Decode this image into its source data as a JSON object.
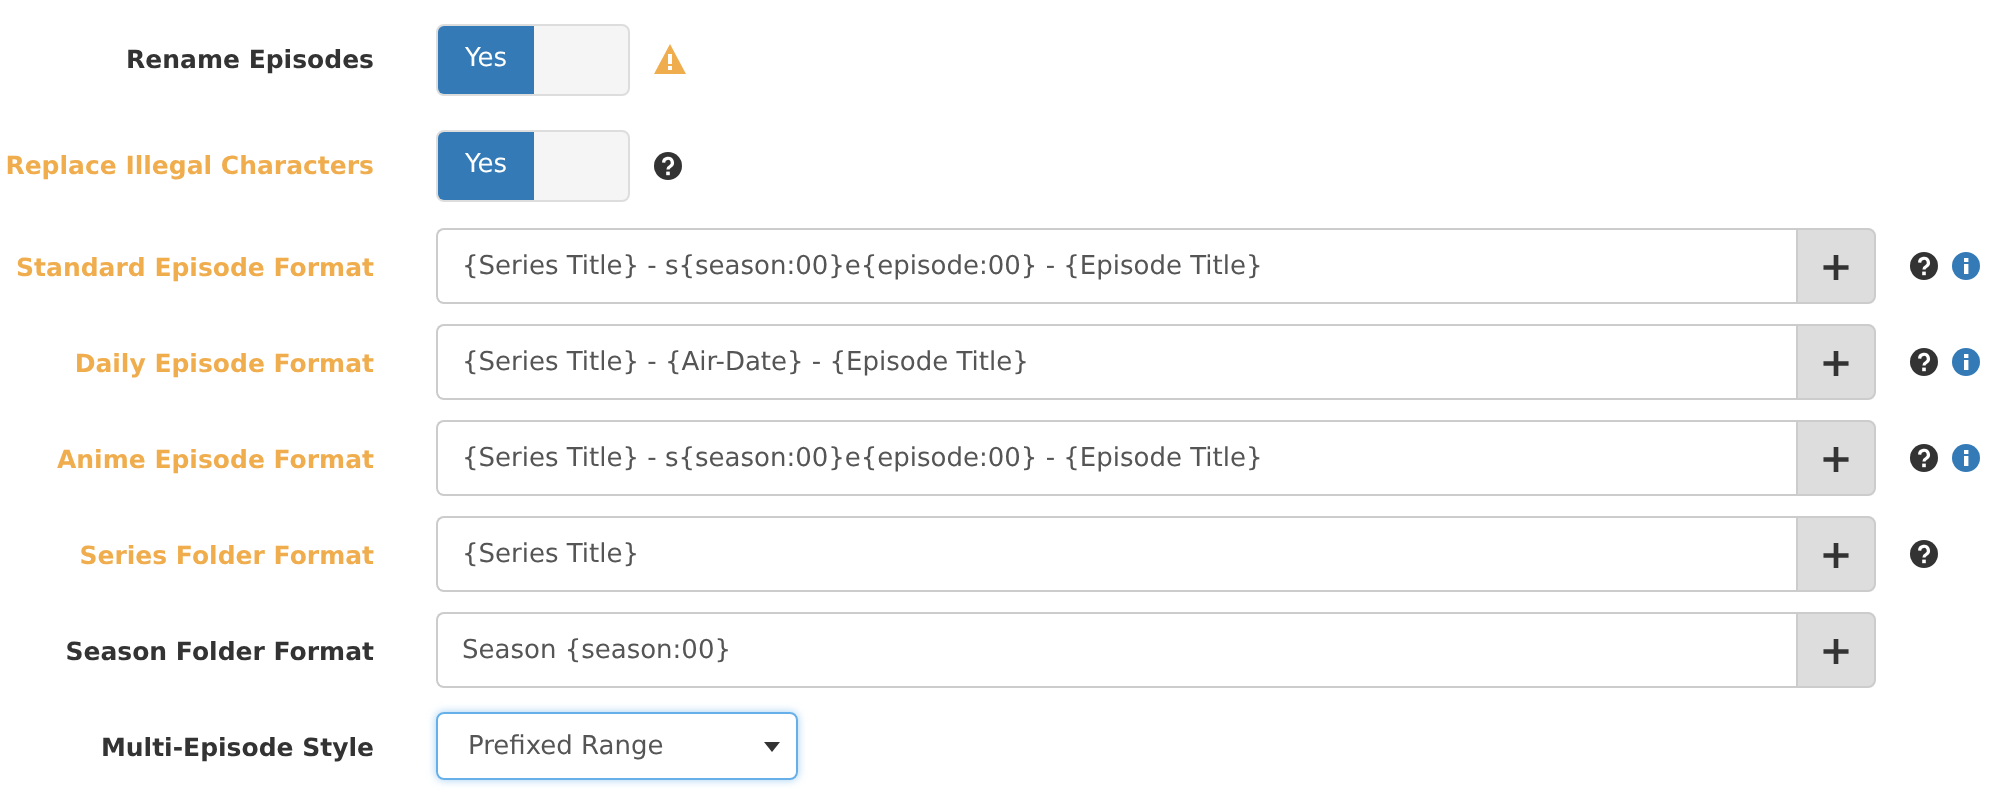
{
  "settings": [
    {
      "kind": "toggle",
      "label": "Rename Episodes",
      "advanced": false,
      "on": true,
      "on_label": "Yes",
      "warning": true
    },
    {
      "kind": "toggle",
      "label": "Replace Illegal Characters",
      "advanced": true,
      "on": true,
      "on_label": "Yes",
      "help": true
    },
    {
      "kind": "text",
      "label": "Standard Episode Format",
      "advanced": true,
      "value": "{Series Title} - s{season:00}e{episode:00} - {Episode Title}",
      "button": "+",
      "help": true,
      "info": true
    },
    {
      "kind": "text",
      "label": "Daily Episode Format",
      "advanced": true,
      "value": "{Series Title} - {Air-Date} - {Episode Title}",
      "button": "+",
      "help": true,
      "info": true
    },
    {
      "kind": "text",
      "label": "Anime Episode Format",
      "advanced": true,
      "value": "{Series Title} - s{season:00}e{episode:00} - {Episode Title}",
      "button": "+",
      "help": true,
      "info": true
    },
    {
      "kind": "text",
      "label": "Series Folder Format",
      "advanced": true,
      "value": "{Series Title}",
      "button": "+",
      "help": true
    },
    {
      "kind": "text",
      "label": "Season Folder Format",
      "advanced": false,
      "value": "Season {season:00}",
      "button": "+"
    },
    {
      "kind": "select",
      "label": "Multi-Episode Style",
      "advanced": false,
      "value": "Prefixed Range",
      "focused": true
    }
  ]
}
